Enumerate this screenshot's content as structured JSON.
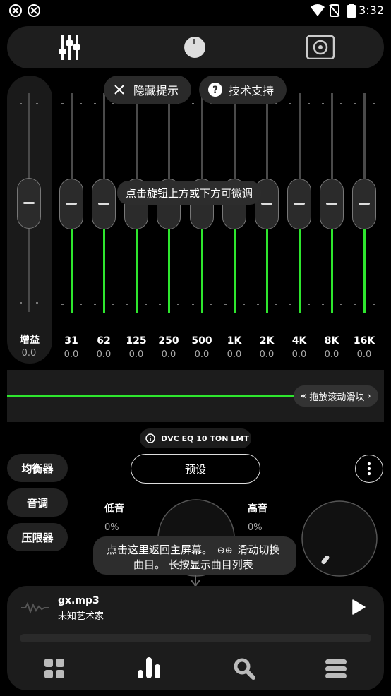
{
  "status_bar": {
    "time": "3:32"
  },
  "eq": {
    "gain_label": "增益",
    "gain_value": "0.0",
    "bands": [
      {
        "freq": "31",
        "value": "0.0"
      },
      {
        "freq": "62",
        "value": "0.0"
      },
      {
        "freq": "125",
        "value": "0.0"
      },
      {
        "freq": "250",
        "value": "0.0"
      },
      {
        "freq": "500",
        "value": "0.0"
      },
      {
        "freq": "1K",
        "value": "0.0"
      },
      {
        "freq": "2K",
        "value": "0.0"
      },
      {
        "freq": "4K",
        "value": "0.0"
      },
      {
        "freq": "8K",
        "value": "0.0"
      },
      {
        "freq": "16K",
        "value": "0.0"
      }
    ],
    "hide_tips_label": "隐藏提示",
    "support_label": "技术支持",
    "fine_tune_tip": "点击旋钮上方或下方可微调"
  },
  "graph": {
    "drag_label": "拖放滚动滑块"
  },
  "preset_badge": "DVC EQ 10 TON LMT",
  "side_buttons": [
    "均衡器",
    "音调",
    "压限器"
  ],
  "preset_button": "预设",
  "tone": {
    "bass_label": "低音",
    "bass_value": "0%",
    "treble_label": "高音",
    "treble_value": "0%"
  },
  "player_tip": {
    "line1": "点击这里返回主屏幕。",
    "line1b": "滑动切换",
    "line2": "曲目。 长按显示曲目列表"
  },
  "now_playing": {
    "title": "gx.mp3",
    "artist": "未知艺术家"
  },
  "colors": {
    "accent_green": "#2ee62e",
    "panel": "#1e1e1e"
  }
}
